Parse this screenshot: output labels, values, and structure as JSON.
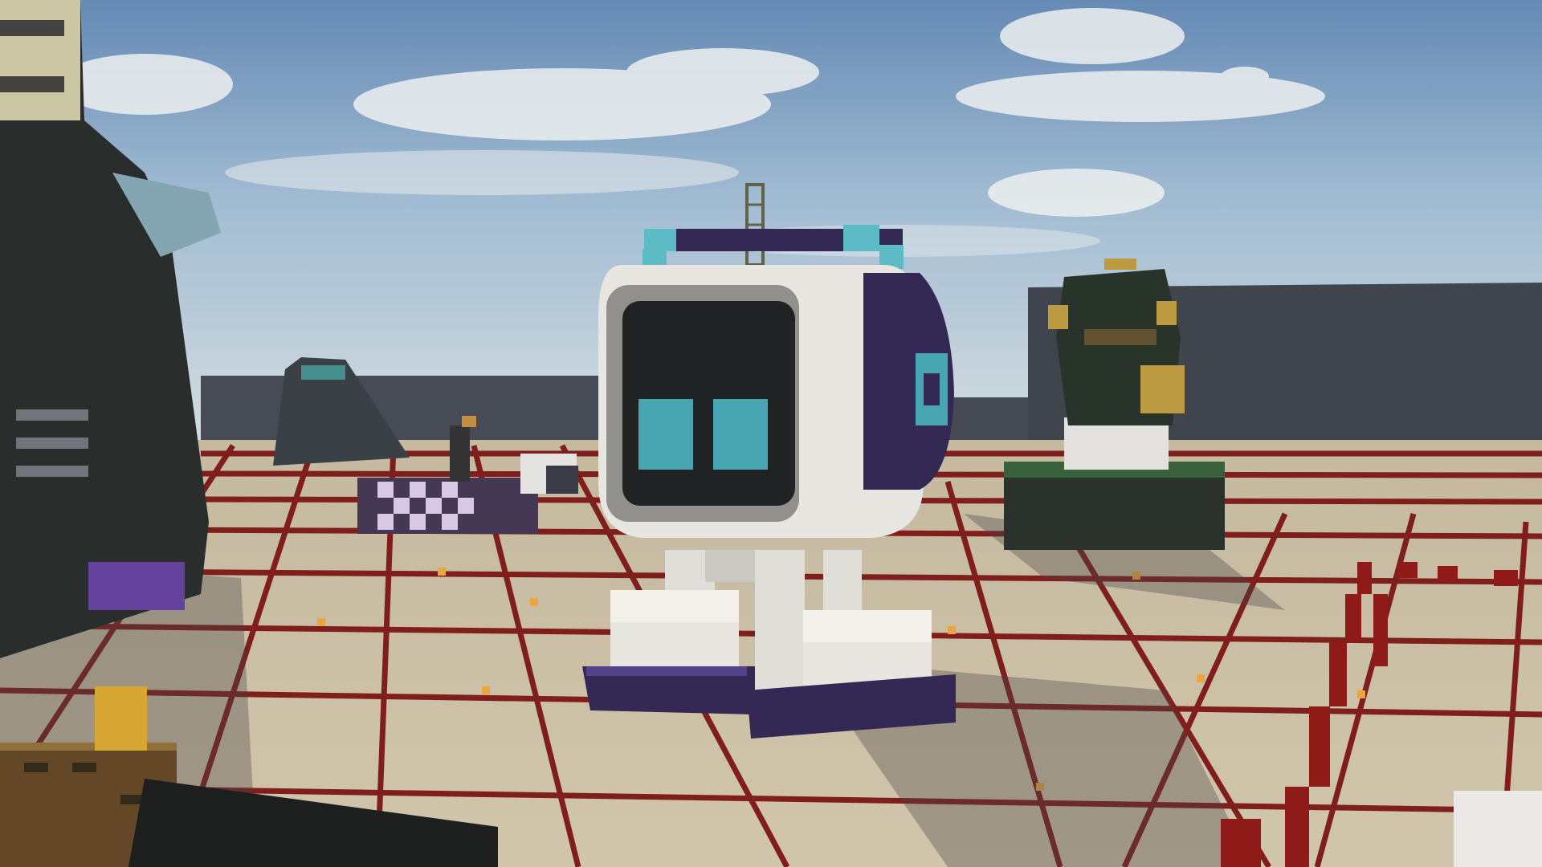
{
  "scene": {
    "kind": "voxel-build-screenshot",
    "hud_visible": false
  },
  "palette": {
    "sky_top": "#5d85b4",
    "sky_mid": "#9dbad4",
    "sky_horizon": "#d3dde2",
    "cloud": "#eef1f2",
    "wall": "#3d4350",
    "wall_dark": "#2f3440",
    "floor": "#cbbfa6",
    "floor_shade": "#a89d88",
    "grid_line": "#7a1414",
    "grid_node": "#e8a33a",
    "robot_white": "#e7e6e2",
    "robot_grey": "#8c8c8a",
    "robot_screen": "#15181c",
    "robot_eye": "#3fa3b3",
    "robot_purple": "#2a1f4e",
    "robot_teal": "#55b9c6",
    "statue_green": "#1f2e22",
    "statue_gold": "#b9963a",
    "redstone": "#8a1010",
    "crate": "#6b4a22",
    "gold_block": "#d4a42c"
  }
}
